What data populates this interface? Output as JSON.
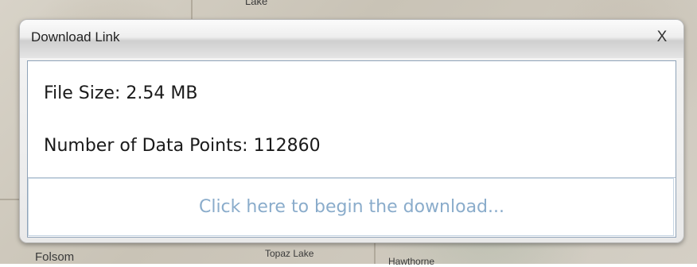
{
  "map": {
    "labels": {
      "top_fragment": "Lake",
      "folsom": "Folsom",
      "topaz_lake": "Topaz Lake",
      "hawthorne": "Hawthorne"
    }
  },
  "dialog": {
    "title": "Download Link",
    "close_label": "X",
    "file_size": "File Size: 2.54 MB",
    "data_points": "Number of Data Points: 112860",
    "download_link": "Click here to begin the download..."
  },
  "colors": {
    "link": "#8aaccb",
    "body_border": "#8fa3b8"
  }
}
